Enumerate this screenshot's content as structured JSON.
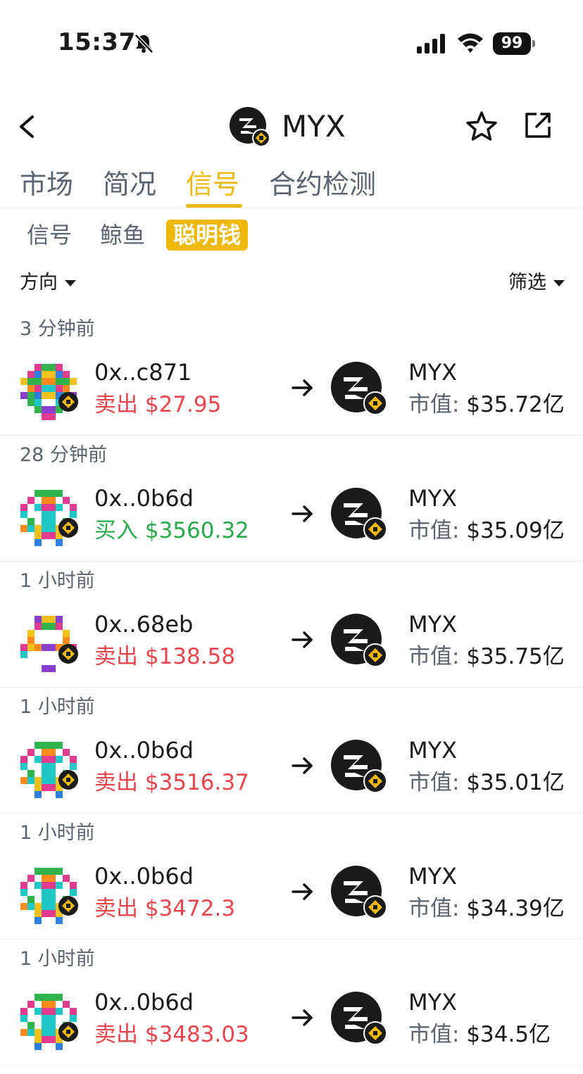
{
  "status_bar": {
    "time": "15:37",
    "battery": "99"
  },
  "header": {
    "title": "MYX"
  },
  "main_tabs": [
    {
      "label": "市场"
    },
    {
      "label": "简况"
    },
    {
      "label": "信号"
    },
    {
      "label": "合约检测"
    }
  ],
  "active_main_tab": "信号",
  "sub_tabs": [
    {
      "label": "信号"
    },
    {
      "label": "鲸鱼"
    },
    {
      "label": "聪明钱"
    }
  ],
  "active_sub_tab": "聪明钱",
  "filters": {
    "direction": "方向",
    "filter": "筛选"
  },
  "colors": {
    "accent": "#efb90b",
    "sell": "#e8464f",
    "buy": "#2aa84d",
    "muted": "#5c6470"
  },
  "signals": [
    {
      "time": "3 分钟前",
      "address": "0x..c871",
      "action": "卖出",
      "amount": "$27.95",
      "side": "sell",
      "symbol": "MYX",
      "mcap_label": "市值:",
      "mcap_value": "$35.72亿"
    },
    {
      "time": "28 分钟前",
      "address": "0x..0b6d",
      "action": "买入",
      "amount": "$3560.32",
      "side": "buy",
      "symbol": "MYX",
      "mcap_label": "市值:",
      "mcap_value": "$35.09亿"
    },
    {
      "time": "1 小时前",
      "address": "0x..68eb",
      "action": "卖出",
      "amount": "$138.58",
      "side": "sell",
      "symbol": "MYX",
      "mcap_label": "市值:",
      "mcap_value": "$35.75亿"
    },
    {
      "time": "1 小时前",
      "address": "0x..0b6d",
      "action": "卖出",
      "amount": "$3516.37",
      "side": "sell",
      "symbol": "MYX",
      "mcap_label": "市值:",
      "mcap_value": "$35.01亿"
    },
    {
      "time": "1 小时前",
      "address": "0x..0b6d",
      "action": "卖出",
      "amount": "$3472.3",
      "side": "sell",
      "symbol": "MYX",
      "mcap_label": "市值:",
      "mcap_value": "$34.39亿"
    },
    {
      "time": "1 小时前",
      "address": "0x..0b6d",
      "action": "卖出",
      "amount": "$3483.03",
      "side": "sell",
      "symbol": "MYX",
      "mcap_label": "市值:",
      "mcap_value": "$34.5亿"
    }
  ]
}
